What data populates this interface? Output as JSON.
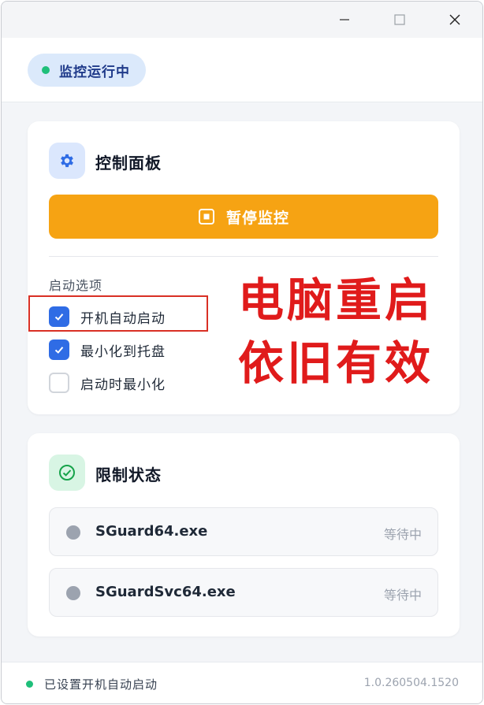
{
  "window": {
    "controls": {
      "minimize_icon": "minimize-icon",
      "maximize_icon": "maximize-icon",
      "close_icon": "close-icon"
    }
  },
  "header": {
    "status_text": "监控运行中",
    "status_color": "#1fbf7a"
  },
  "control_panel": {
    "title": "控制面板",
    "icon": "gear-icon",
    "pause_button_label": "暂停监控",
    "pause_button_color": "#f6a313",
    "startup_section_label": "启动选项",
    "options": [
      {
        "label": "开机自动启动",
        "checked": true
      },
      {
        "label": "最小化到托盘",
        "checked": true
      },
      {
        "label": "启动时最小化",
        "checked": false
      }
    ]
  },
  "overlay": {
    "line1": "电脑重启",
    "line2": "依旧有效",
    "color": "#e01b1b"
  },
  "limit_status": {
    "title": "限制状态",
    "icon": "check-circle-icon",
    "processes": [
      {
        "name": "SGuard64.exe",
        "state": "等待中"
      },
      {
        "name": "SGuardSvc64.exe",
        "state": "等待中"
      }
    ]
  },
  "footer": {
    "status_text": "已设置开机自动启动",
    "version": "1.0.260504.1520"
  }
}
